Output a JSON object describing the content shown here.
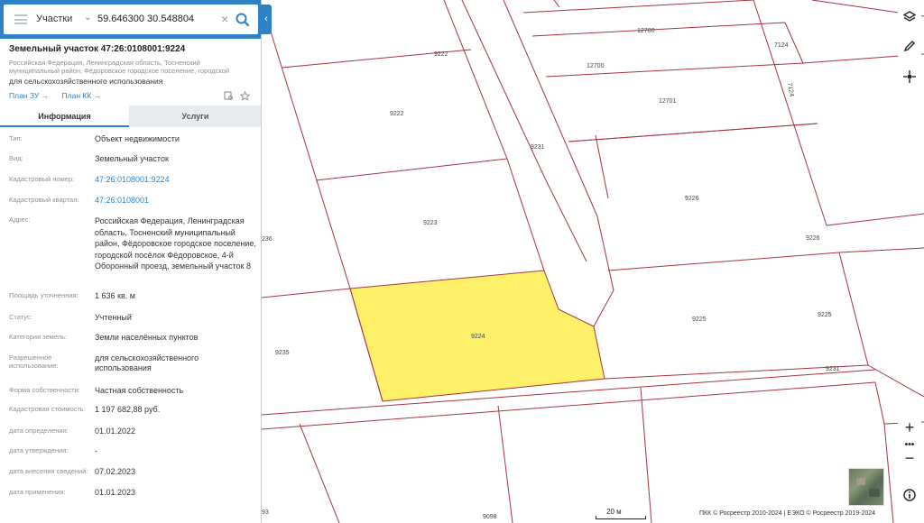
{
  "search": {
    "layer": "Участки",
    "query": "59.646300 30.548804"
  },
  "parcel": {
    "title": "Земельный участок 47:26:0108001:9224",
    "address_short": "Российская Федерация, Ленинградская область, Тосненский муниципальный район, Фёдоровское городское поселение, городской посёлок Фёдоровское, ...",
    "usage": "для сельскохозяйственного использования",
    "links": [
      "План ЗУ →",
      "План КК →"
    ]
  },
  "tabs": {
    "info": "Информация",
    "services": "Услуги"
  },
  "info_rows": [
    {
      "key": "Тип:",
      "value": "Объект недвижимости"
    },
    {
      "key": "Вид:",
      "value": "Земельный участок"
    },
    {
      "key": "Кадастровый номер:",
      "value": "47:26:0108001:9224"
    },
    {
      "key": "Кадастровый квартал:",
      "value": "47:26:0108001"
    },
    {
      "key": "Адрес:",
      "value": "Российская Федерация, Ленинградская область, Тосненский муниципальный район, Фёдоровское городское поселение, городской посёлок Фёдоровское, 4-й Оборонный проезд, земельный участок 8"
    },
    {
      "key": "Площадь уточненная:",
      "value": "1 636 кв. м"
    },
    {
      "key": "Статус:",
      "value": "Учтенный"
    },
    {
      "key": "Категория земель:",
      "value": "Земли населённых пунктов"
    },
    {
      "key": "Разрешенное использование:",
      "value": "для сельскохозяйственного использования"
    },
    {
      "key": "Форма собственности:",
      "value": "Частная собственность"
    },
    {
      "key": "Кадастровая стоимость:",
      "value": "1 197 682,88 руб."
    },
    {
      "key": "дата определения:",
      "value": "01.01.2022"
    },
    {
      "key": "дата утверждения:",
      "value": "-"
    },
    {
      "key": "дата внесения сведений:",
      "value": "07.02.2023"
    },
    {
      "key": "дата применения:",
      "value": "01.01.2023"
    }
  ],
  "map": {
    "labels": [
      "12700",
      "12700",
      "7124",
      "7124",
      "9222",
      "9222",
      "12701",
      "9231",
      "9226",
      "9226",
      "9223",
      "236",
      "9224",
      "9225",
      "9225",
      "9235",
      "9231",
      "93",
      "9098"
    ],
    "highlight_color": "#fff06a",
    "boundary_color": "#a8333e",
    "scale": "20 м",
    "attribution": "ПКК © Росреестр 2010-2024 | ЕЭКО © Росреестр 2019-2024"
  }
}
